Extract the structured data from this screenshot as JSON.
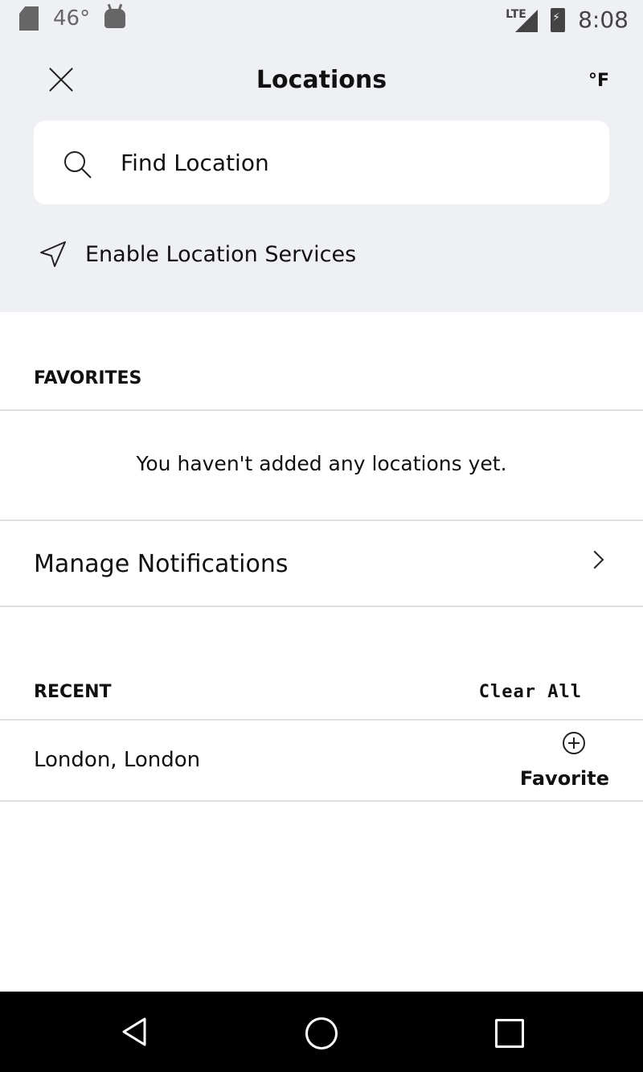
{
  "status_bar": {
    "temperature": "46°",
    "network": "LTE",
    "time": "8:08"
  },
  "header": {
    "title": "Locations",
    "unit": "°F"
  },
  "search": {
    "placeholder": "Find Location"
  },
  "location_services": {
    "label": "Enable Location Services"
  },
  "favorites": {
    "header": "FAVORITES",
    "empty_message": "You haven't added any locations yet."
  },
  "manage_notifications": {
    "label": "Manage Notifications"
  },
  "recent": {
    "header": "RECENT",
    "clear_all": "Clear All",
    "items": [
      {
        "name": "London, London",
        "action_label": "Favorite"
      }
    ]
  }
}
